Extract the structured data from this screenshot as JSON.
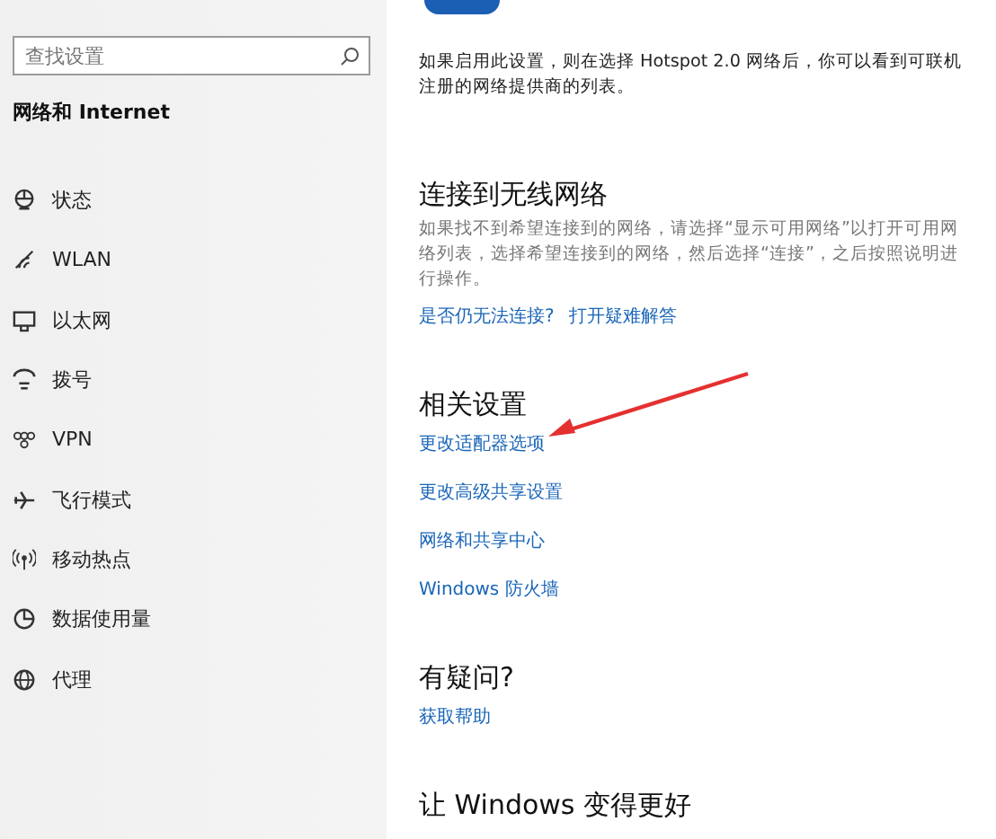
{
  "sidebar": {
    "search": {
      "placeholder": "查找设置"
    },
    "section_title": "网络和 Internet",
    "items": [
      {
        "label": "状态"
      },
      {
        "label": "WLAN"
      },
      {
        "label": "以太网"
      },
      {
        "label": "拨号"
      },
      {
        "label": "VPN"
      },
      {
        "label": "飞行模式"
      },
      {
        "label": "移动热点"
      },
      {
        "label": "数据使用量"
      },
      {
        "label": "代理"
      }
    ]
  },
  "content": {
    "toggle": {
      "on": true
    },
    "hotspot_description": "如果启用此设置，则在选择 Hotspot 2.0 网络后，你可以看到可联机注册的网络提供商的列表。",
    "sections": [
      {
        "title": "连接到无线网络",
        "description": "如果找不到希望连接到的网络，请选择“显示可用网络”以打开可用网络列表，选择希望连接到的网络，然后选择“连接”，之后按照说明进行操作。",
        "inline_links": [
          "是否仍无法连接?",
          "打开疑难解答"
        ]
      },
      {
        "title": "相关设置",
        "links": [
          "更改适配器选项",
          "更改高级共享设置",
          "网络和共享中心",
          "Windows 防火墙"
        ]
      },
      {
        "title": "有疑问?",
        "links": [
          "获取帮助"
        ]
      },
      {
        "title": "让 Windows 变得更好"
      }
    ]
  }
}
